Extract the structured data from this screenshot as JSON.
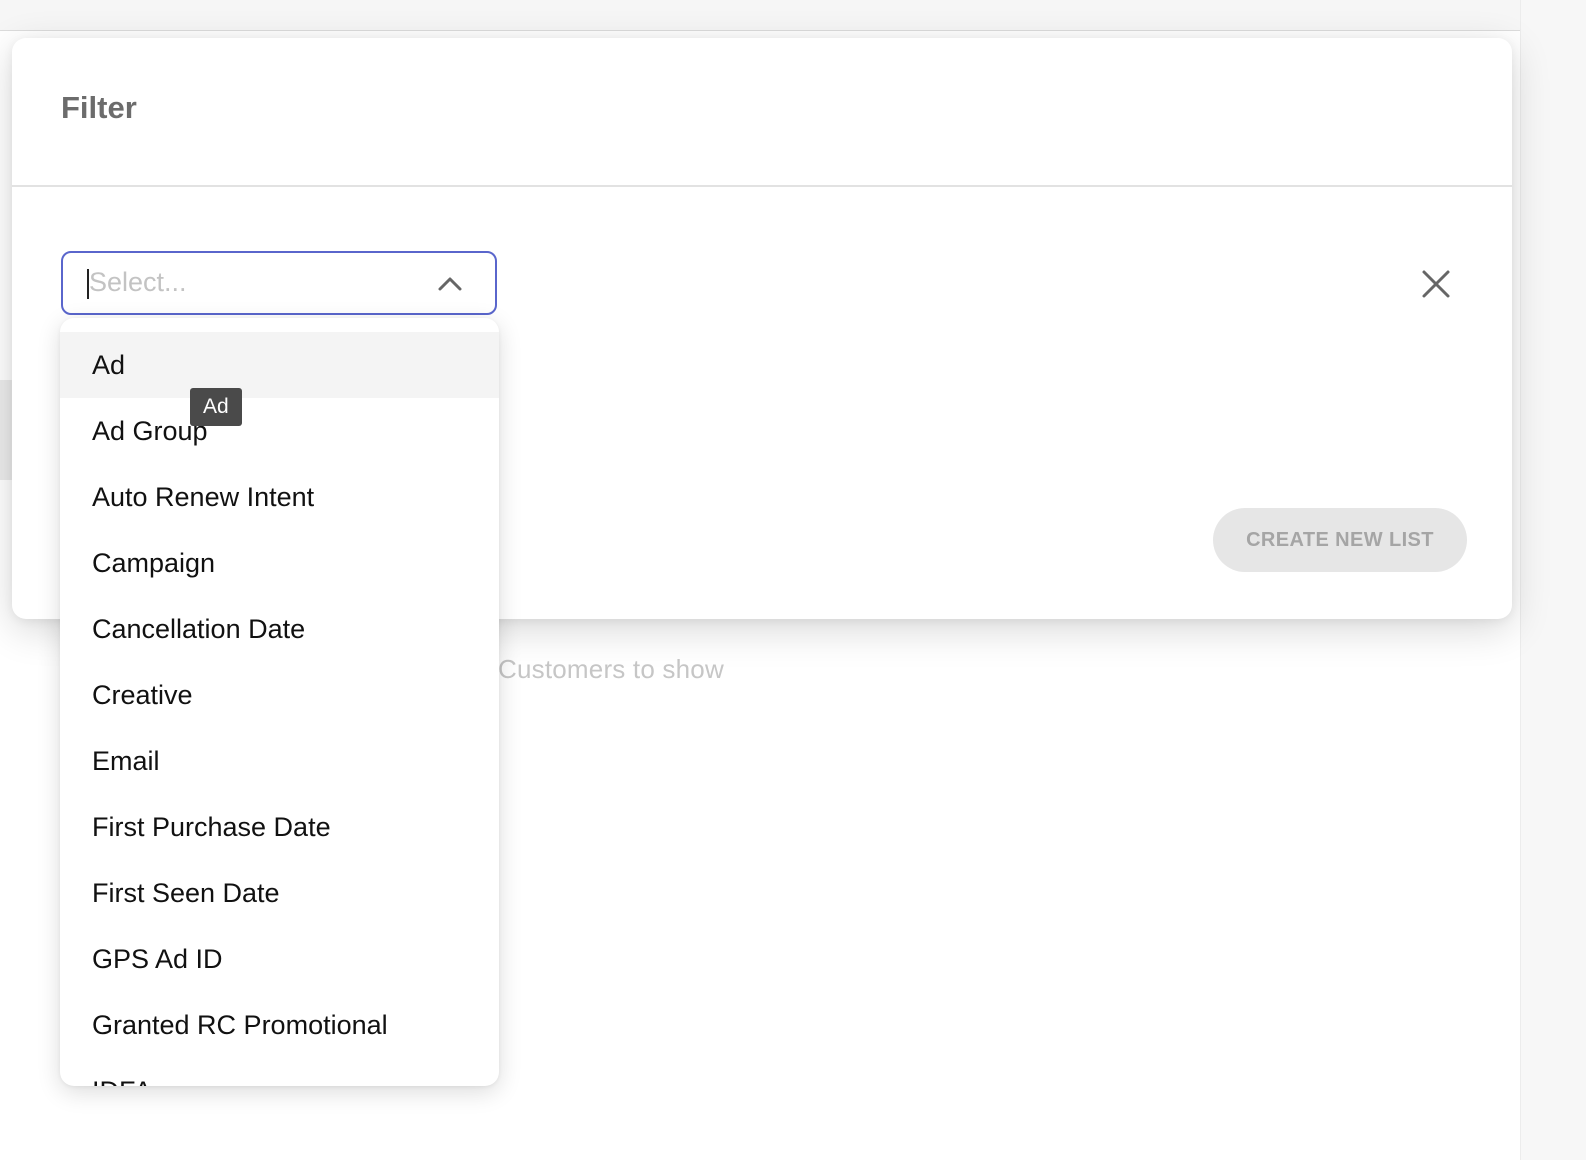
{
  "modal": {
    "title": "Filter",
    "select": {
      "placeholder": "Select..."
    },
    "create_button_label": "CREATE NEW LIST"
  },
  "background": {
    "empty_state_text": "Customers to show"
  },
  "dropdown": {
    "items": [
      {
        "label": "Ad"
      },
      {
        "label": "Ad Group"
      },
      {
        "label": "Auto Renew Intent"
      },
      {
        "label": "Campaign"
      },
      {
        "label": "Cancellation Date"
      },
      {
        "label": "Creative"
      },
      {
        "label": "Email"
      },
      {
        "label": "First Purchase Date"
      },
      {
        "label": "First Seen Date"
      },
      {
        "label": "GPS Ad ID"
      },
      {
        "label": "Granted RC Promotional"
      },
      {
        "label": "IDFA"
      }
    ],
    "highlighted_index": 0
  },
  "tooltip": {
    "text": "Ad"
  },
  "icons": {
    "chevron": "chevron-up-icon",
    "close": "close-icon"
  },
  "colors": {
    "focus_border": "#5a66cc",
    "disabled_button_bg": "#e6e6e6",
    "disabled_button_text": "#a5a5a5",
    "tooltip_bg": "#4a4a4a"
  }
}
